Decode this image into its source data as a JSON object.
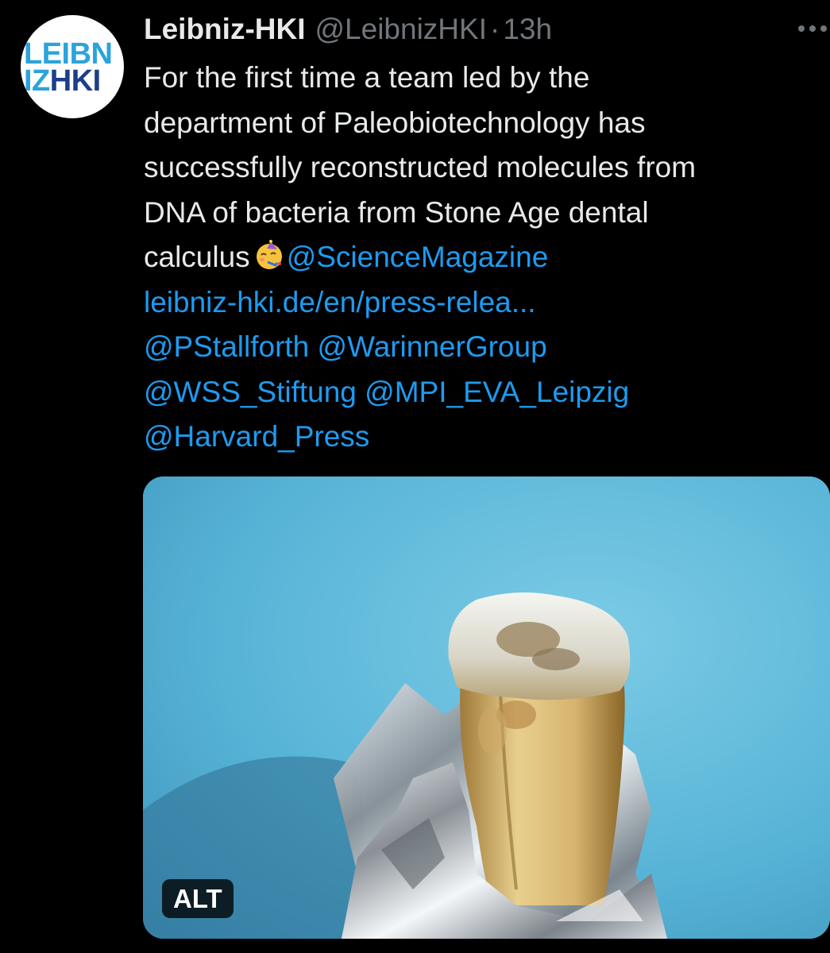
{
  "author": {
    "name": "Leibniz-HKI",
    "handle": "@LeibnizHKI",
    "separator": "·",
    "time": "13h",
    "avatar_logo_top": "LEIBN",
    "avatar_logo_bottom_a": "IZ",
    "avatar_logo_bottom_b": "HKI"
  },
  "tweet": {
    "line1": "For the first time a team led by the",
    "line2": "department of Paleobiotechnology has",
    "line3": "successfully reconstructed molecules from",
    "line4": "DNA of bacteria from Stone Age dental",
    "line5_text": "calculus",
    "emoji": "partying-face-emoji",
    "mention_science": "@ScienceMagazine",
    "url": "leibniz-hki.de/en/press-relea...",
    "mention_stallforth": "@PStallforth",
    "mention_warinner": "@WarinnerGroup",
    "mention_wss": "@WSS_Stiftung",
    "mention_mpi": "@MPI_EVA_Leipzig",
    "mention_harvard": "@Harvard_Press"
  },
  "media": {
    "alt_label": "ALT",
    "description_icon": "tooth-in-foil-photo"
  },
  "colors": {
    "background": "#000000",
    "text": "#e7e9ea",
    "muted": "#71767b",
    "link": "#1d9bf0",
    "photo_backdrop": "#5fb9d8"
  },
  "icons": {
    "more": "more-horizontal-icon"
  }
}
